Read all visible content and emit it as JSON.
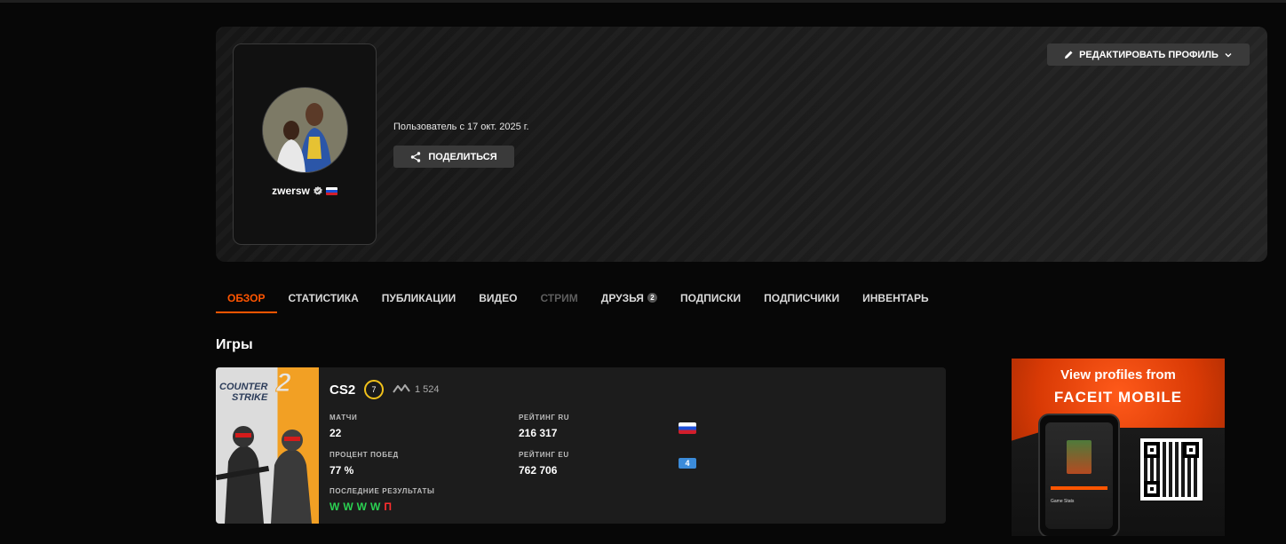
{
  "profile": {
    "username": "zwersw",
    "member_since": "Пользователь с 17 окт. 2025 г.",
    "share_label": "ПОДЕЛИТЬСЯ",
    "edit_label": "РЕДАКТИРОВАТЬ ПРОФИЛЬ",
    "avatar_icon": "avatar-photo",
    "verified_icon": "verified-badge-icon",
    "country_flag": "russia-flag-icon"
  },
  "tabs": [
    {
      "label": "ОБЗОР",
      "state": "active"
    },
    {
      "label": "СТАТИСТИКА",
      "state": "normal"
    },
    {
      "label": "ПУБЛИКАЦИИ",
      "state": "normal"
    },
    {
      "label": "ВИДЕО",
      "state": "normal"
    },
    {
      "label": "СТРИМ",
      "state": "disabled"
    },
    {
      "label": "ДРУЗЬЯ",
      "state": "normal",
      "badge": "2"
    },
    {
      "label": "ПОДПИСКИ",
      "state": "normal"
    },
    {
      "label": "ПОДПИСЧИКИ",
      "state": "normal"
    },
    {
      "label": "ИНВЕНТАРЬ",
      "state": "normal"
    }
  ],
  "games_section": {
    "title": "Игры",
    "game": {
      "logo_line1": "COUNTER",
      "logo_line2": "STRIKE",
      "logo_number": "2",
      "name": "CS2",
      "level": "7",
      "elo": "1 524",
      "matches_label": "МАТЧИ",
      "matches_value": "22",
      "winrate_label": "ПРОЦЕНТ ПОБЕД",
      "winrate_value": "77 %",
      "rating_ru_label": "РЕЙТИНГ RU",
      "rating_ru_value": "216 317",
      "rating_eu_label": "РЕЙТИНГ EU",
      "rating_eu_value": "762 706",
      "eu_flag_text": "4",
      "recent_label": "ПОСЛЕДНИЕ РЕЗУЛЬТАТЫ",
      "recent_results": [
        "W",
        "W",
        "W",
        "W",
        "П"
      ]
    }
  },
  "ad": {
    "line1": "View profiles from",
    "line2": "FACEIT MOBILE",
    "phone_caption": "Game Stats"
  },
  "colors": {
    "accent": "#ff5500",
    "win": "#2bd152",
    "loss": "#ff2e2e",
    "level": "#f2c21b"
  }
}
